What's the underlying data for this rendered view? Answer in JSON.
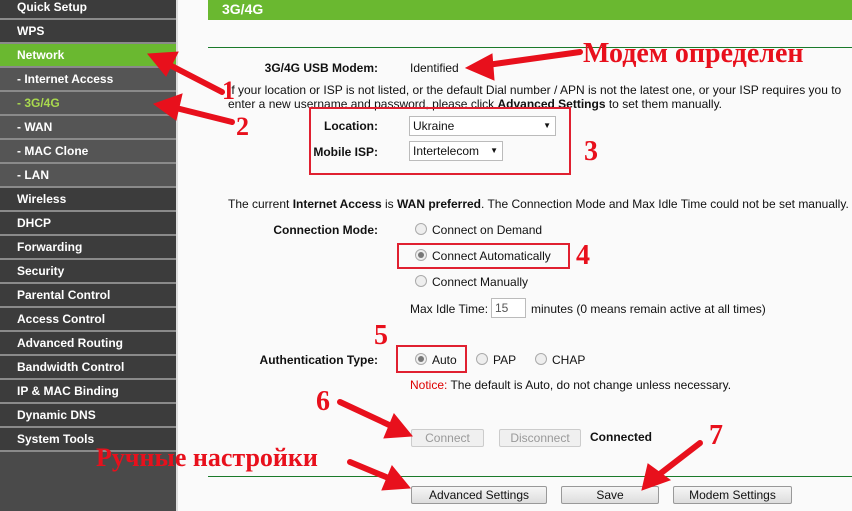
{
  "sidebar": {
    "items": [
      {
        "label": "Quick Setup"
      },
      {
        "label": "WPS"
      },
      {
        "label": "Network"
      },
      {
        "label": "- Internet Access"
      },
      {
        "label": "- 3G/4G"
      },
      {
        "label": "- WAN"
      },
      {
        "label": "- MAC Clone"
      },
      {
        "label": "- LAN"
      },
      {
        "label": "Wireless"
      },
      {
        "label": "DHCP"
      },
      {
        "label": "Forwarding"
      },
      {
        "label": "Security"
      },
      {
        "label": "Parental Control"
      },
      {
        "label": "Access Control"
      },
      {
        "label": "Advanced Routing"
      },
      {
        "label": "Bandwidth Control"
      },
      {
        "label": "IP & MAC Binding"
      },
      {
        "label": "Dynamic DNS"
      },
      {
        "label": "System Tools"
      }
    ]
  },
  "header": {
    "title": "3G/4G"
  },
  "modem": {
    "label": "3G/4G USB Modem:",
    "value": "Identified"
  },
  "info": {
    "pre": "If your location or ISP is not listed, or the default Dial number / APN is not the latest one, or your ISP requires you to enter a new username and password, please click ",
    "bold": "Advanced Settings",
    "post": " to set them manually."
  },
  "location": {
    "label": "Location:",
    "value": "Ukraine"
  },
  "isp": {
    "label": "Mobile ISP:",
    "value": "Intertelecom"
  },
  "wan_note": {
    "a": "The current ",
    "b": "Internet Access",
    "c": " is ",
    "d": "WAN preferred",
    "e": ". The Connection Mode and Max Idle Time could not be set manually."
  },
  "connection_mode": {
    "label": "Connection Mode:",
    "options": [
      "Connect on Demand",
      "Connect Automatically",
      "Connect Manually"
    ],
    "selected": "Connect Automatically"
  },
  "idle": {
    "label": "Max Idle Time:",
    "value": "15",
    "suffix": "minutes (0 means remain active at all times)"
  },
  "auth": {
    "label": "Authentication Type:",
    "options": [
      "Auto",
      "PAP",
      "CHAP"
    ],
    "selected": "Auto"
  },
  "notice": {
    "label": "Notice:",
    "text": " The default is Auto, do not change unless necessary."
  },
  "buttons": {
    "connect": "Connect",
    "disconnect": "Disconnect",
    "status": "Connected",
    "advanced": "Advanced Settings",
    "save": "Save",
    "modem": "Modem Settings"
  },
  "annotations": {
    "modem_detected": "Модем определен",
    "manual": "Ручные настройки",
    "n1": "1",
    "n2": "2",
    "n3": "3",
    "n4": "4",
    "n5": "5",
    "n6": "6",
    "n7": "7"
  },
  "colors": {
    "accent": "#6ab830",
    "annotation": "#e8101c"
  }
}
